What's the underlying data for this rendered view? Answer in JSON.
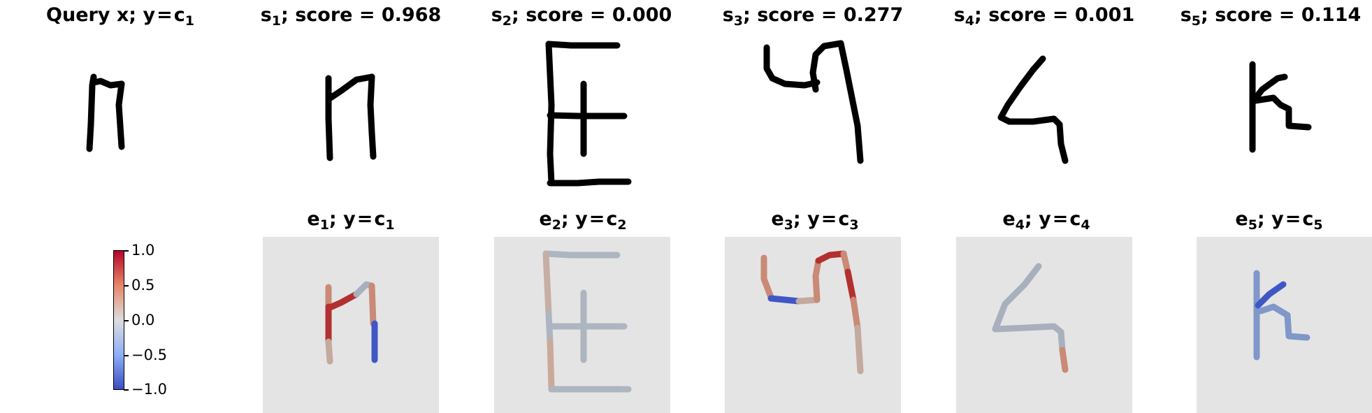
{
  "top_titles": [
    {
      "symbol": "Query x",
      "rest": "; y",
      "eq": "=",
      "rhs": "c",
      "rhs_sub": "1",
      "has_score": false
    },
    {
      "symbol": "s",
      "sub": "1",
      "rest": "; score = 0.968",
      "has_score": true
    },
    {
      "symbol": "s",
      "sub": "2",
      "rest": "; score = 0.000",
      "has_score": true
    },
    {
      "symbol": "s",
      "sub": "3",
      "rest": "; score = 0.277",
      "has_score": true
    },
    {
      "symbol": "s",
      "sub": "4",
      "rest": "; score = 0.001",
      "has_score": true
    },
    {
      "symbol": "s",
      "sub": "5",
      "rest": "; score = 0.114",
      "has_score": true
    }
  ],
  "bottom_titles": [
    {
      "symbol": "e",
      "sub": "1",
      "rest": "; y",
      "eq": "=",
      "rhs": "c",
      "rhs_sub": "1"
    },
    {
      "symbol": "e",
      "sub": "2",
      "rest": "; y",
      "eq": "=",
      "rhs": "c",
      "rhs_sub": "2"
    },
    {
      "symbol": "e",
      "sub": "3",
      "rest": "; y",
      "eq": "=",
      "rhs": "c",
      "rhs_sub": "3"
    },
    {
      "symbol": "e",
      "sub": "4",
      "rest": "; y",
      "eq": "=",
      "rhs": "c",
      "rhs_sub": "4"
    },
    {
      "symbol": "e",
      "sub": "5",
      "rest": "; y",
      "eq": "=",
      "rhs": "c",
      "rhs_sub": "5"
    }
  ],
  "colorbar": {
    "ticks": [
      "1.0",
      "0.5",
      "0.0",
      "−0.5",
      "−1.0"
    ],
    "colormap": "coolwarm",
    "stops": [
      "#b40426",
      "#e07a5f",
      "#dddddd",
      "#7b9ff9",
      "#3b4cc0"
    ]
  },
  "colors": {
    "stroke": "#000000",
    "panel_bg": "#e4e4e4",
    "positive_strong": "#b2302f",
    "positive_mid": "#c98a76",
    "neutral": "#a8b0bd",
    "negative_mid": "#7f97c9",
    "negative_strong": "#3f57c6"
  }
}
